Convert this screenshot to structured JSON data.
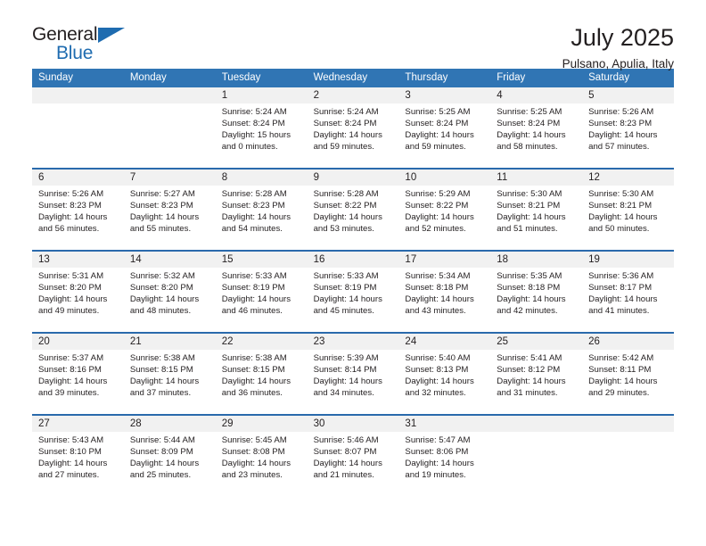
{
  "logo": {
    "word_one": "General",
    "word_two": "Blue",
    "triangle_icon": "triangle-icon",
    "accent_color": "#1f6cb0"
  },
  "header": {
    "title": "July 2025",
    "location": "Pulsano, Apulia, Italy"
  },
  "colors": {
    "header_blue": "#3075b4",
    "row_rule_blue": "#2a6aac",
    "daynum_band": "#f1f1f1",
    "text": "#231f20"
  },
  "weekdays": [
    "Sunday",
    "Monday",
    "Tuesday",
    "Wednesday",
    "Thursday",
    "Friday",
    "Saturday"
  ],
  "weeks": [
    [
      {
        "day": "",
        "lines": []
      },
      {
        "day": "",
        "lines": []
      },
      {
        "day": "1",
        "lines": [
          "Sunrise: 5:24 AM",
          "Sunset: 8:24 PM",
          "Daylight: 15 hours",
          "and 0 minutes."
        ]
      },
      {
        "day": "2",
        "lines": [
          "Sunrise: 5:24 AM",
          "Sunset: 8:24 PM",
          "Daylight: 14 hours",
          "and 59 minutes."
        ]
      },
      {
        "day": "3",
        "lines": [
          "Sunrise: 5:25 AM",
          "Sunset: 8:24 PM",
          "Daylight: 14 hours",
          "and 59 minutes."
        ]
      },
      {
        "day": "4",
        "lines": [
          "Sunrise: 5:25 AM",
          "Sunset: 8:24 PM",
          "Daylight: 14 hours",
          "and 58 minutes."
        ]
      },
      {
        "day": "5",
        "lines": [
          "Sunrise: 5:26 AM",
          "Sunset: 8:23 PM",
          "Daylight: 14 hours",
          "and 57 minutes."
        ]
      }
    ],
    [
      {
        "day": "6",
        "lines": [
          "Sunrise: 5:26 AM",
          "Sunset: 8:23 PM",
          "Daylight: 14 hours",
          "and 56 minutes."
        ]
      },
      {
        "day": "7",
        "lines": [
          "Sunrise: 5:27 AM",
          "Sunset: 8:23 PM",
          "Daylight: 14 hours",
          "and 55 minutes."
        ]
      },
      {
        "day": "8",
        "lines": [
          "Sunrise: 5:28 AM",
          "Sunset: 8:23 PM",
          "Daylight: 14 hours",
          "and 54 minutes."
        ]
      },
      {
        "day": "9",
        "lines": [
          "Sunrise: 5:28 AM",
          "Sunset: 8:22 PM",
          "Daylight: 14 hours",
          "and 53 minutes."
        ]
      },
      {
        "day": "10",
        "lines": [
          "Sunrise: 5:29 AM",
          "Sunset: 8:22 PM",
          "Daylight: 14 hours",
          "and 52 minutes."
        ]
      },
      {
        "day": "11",
        "lines": [
          "Sunrise: 5:30 AM",
          "Sunset: 8:21 PM",
          "Daylight: 14 hours",
          "and 51 minutes."
        ]
      },
      {
        "day": "12",
        "lines": [
          "Sunrise: 5:30 AM",
          "Sunset: 8:21 PM",
          "Daylight: 14 hours",
          "and 50 minutes."
        ]
      }
    ],
    [
      {
        "day": "13",
        "lines": [
          "Sunrise: 5:31 AM",
          "Sunset: 8:20 PM",
          "Daylight: 14 hours",
          "and 49 minutes."
        ]
      },
      {
        "day": "14",
        "lines": [
          "Sunrise: 5:32 AM",
          "Sunset: 8:20 PM",
          "Daylight: 14 hours",
          "and 48 minutes."
        ]
      },
      {
        "day": "15",
        "lines": [
          "Sunrise: 5:33 AM",
          "Sunset: 8:19 PM",
          "Daylight: 14 hours",
          "and 46 minutes."
        ]
      },
      {
        "day": "16",
        "lines": [
          "Sunrise: 5:33 AM",
          "Sunset: 8:19 PM",
          "Daylight: 14 hours",
          "and 45 minutes."
        ]
      },
      {
        "day": "17",
        "lines": [
          "Sunrise: 5:34 AM",
          "Sunset: 8:18 PM",
          "Daylight: 14 hours",
          "and 43 minutes."
        ]
      },
      {
        "day": "18",
        "lines": [
          "Sunrise: 5:35 AM",
          "Sunset: 8:18 PM",
          "Daylight: 14 hours",
          "and 42 minutes."
        ]
      },
      {
        "day": "19",
        "lines": [
          "Sunrise: 5:36 AM",
          "Sunset: 8:17 PM",
          "Daylight: 14 hours",
          "and 41 minutes."
        ]
      }
    ],
    [
      {
        "day": "20",
        "lines": [
          "Sunrise: 5:37 AM",
          "Sunset: 8:16 PM",
          "Daylight: 14 hours",
          "and 39 minutes."
        ]
      },
      {
        "day": "21",
        "lines": [
          "Sunrise: 5:38 AM",
          "Sunset: 8:15 PM",
          "Daylight: 14 hours",
          "and 37 minutes."
        ]
      },
      {
        "day": "22",
        "lines": [
          "Sunrise: 5:38 AM",
          "Sunset: 8:15 PM",
          "Daylight: 14 hours",
          "and 36 minutes."
        ]
      },
      {
        "day": "23",
        "lines": [
          "Sunrise: 5:39 AM",
          "Sunset: 8:14 PM",
          "Daylight: 14 hours",
          "and 34 minutes."
        ]
      },
      {
        "day": "24",
        "lines": [
          "Sunrise: 5:40 AM",
          "Sunset: 8:13 PM",
          "Daylight: 14 hours",
          "and 32 minutes."
        ]
      },
      {
        "day": "25",
        "lines": [
          "Sunrise: 5:41 AM",
          "Sunset: 8:12 PM",
          "Daylight: 14 hours",
          "and 31 minutes."
        ]
      },
      {
        "day": "26",
        "lines": [
          "Sunrise: 5:42 AM",
          "Sunset: 8:11 PM",
          "Daylight: 14 hours",
          "and 29 minutes."
        ]
      }
    ],
    [
      {
        "day": "27",
        "lines": [
          "Sunrise: 5:43 AM",
          "Sunset: 8:10 PM",
          "Daylight: 14 hours",
          "and 27 minutes."
        ]
      },
      {
        "day": "28",
        "lines": [
          "Sunrise: 5:44 AM",
          "Sunset: 8:09 PM",
          "Daylight: 14 hours",
          "and 25 minutes."
        ]
      },
      {
        "day": "29",
        "lines": [
          "Sunrise: 5:45 AM",
          "Sunset: 8:08 PM",
          "Daylight: 14 hours",
          "and 23 minutes."
        ]
      },
      {
        "day": "30",
        "lines": [
          "Sunrise: 5:46 AM",
          "Sunset: 8:07 PM",
          "Daylight: 14 hours",
          "and 21 minutes."
        ]
      },
      {
        "day": "31",
        "lines": [
          "Sunrise: 5:47 AM",
          "Sunset: 8:06 PM",
          "Daylight: 14 hours",
          "and 19 minutes."
        ]
      },
      {
        "day": "",
        "lines": []
      },
      {
        "day": "",
        "lines": []
      }
    ]
  ]
}
